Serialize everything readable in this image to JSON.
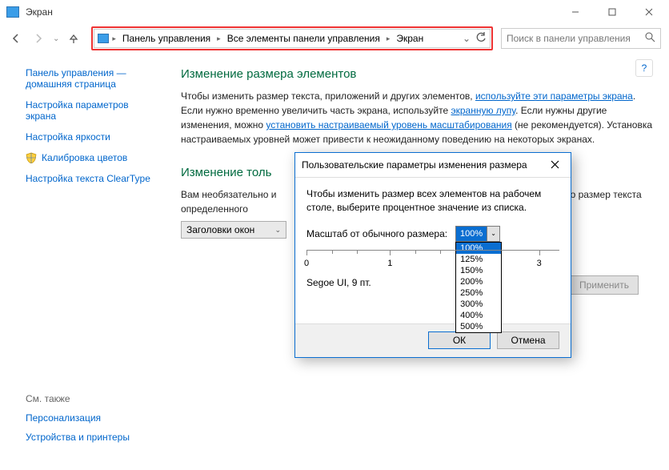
{
  "window": {
    "title": "Экран"
  },
  "breadcrumbs": {
    "b1": "Панель управления",
    "b2": "Все элементы панели управления",
    "b3": "Экран"
  },
  "search": {
    "placeholder": "Поиск в панели управления"
  },
  "sidebar": {
    "head1": "Панель управления —",
    "head2": "домашняя страница",
    "links": {
      "l1a": "Настройка параметров",
      "l1b": "экрана",
      "l2": "Настройка яркости",
      "l3": "Калибровка цветов",
      "l4": "Настройка текста ClearType"
    }
  },
  "main": {
    "h1": "Изменение размера элементов",
    "p1a": "Чтобы изменить размер текста, приложений и других элементов, ",
    "p1link1": "используйте эти параметры экрана",
    "p1b": ". Если нужно временно увеличить часть экрана, используйте ",
    "p1link2": "экранную лупу",
    "p1c": ". Если нужны другие изменения, можно ",
    "p1link3": "установить настраиваемый уровень масштабирования",
    "p1d": " (не рекомендуется). Установка настраиваемых уровней может привести к неожиданному поведению на некоторых экранах.",
    "h2": "Изменение толь",
    "p2a": "Вам необязательно и",
    "p2b": "только размер текста определенного",
    "select_label": "Заголовки окон",
    "apply": "Применить"
  },
  "dialog": {
    "title": "Пользовательские параметры изменения размера",
    "desc": "Чтобы изменить размер всех элементов на рабочем столе, выберите процентное значение из списка.",
    "scale_label": "Масштаб от обычного размера:",
    "scale_value": "100%",
    "options": {
      "o1": "100%",
      "o2": "125%",
      "o3": "150%",
      "o4": "200%",
      "o5": "250%",
      "o6": "300%",
      "o7": "400%",
      "o8": "500%"
    },
    "ruler": {
      "t0": "0",
      "t1": "1",
      "t3": "3"
    },
    "font_sample": "Segoe UI, 9 пт.",
    "ok": "ОК",
    "cancel": "Отмена"
  },
  "see_also": {
    "head": "См. также",
    "l1": "Персонализация",
    "l2": "Устройства и принтеры"
  }
}
